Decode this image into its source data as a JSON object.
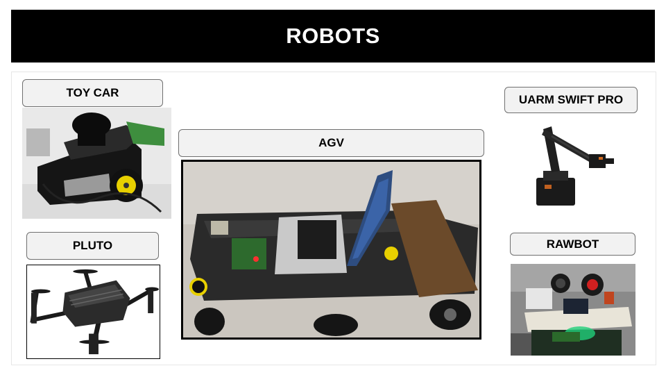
{
  "slide": {
    "title": "ROBOTS"
  },
  "robots": {
    "toy_car": {
      "label": "TOY CAR",
      "image": "toy-car-photo"
    },
    "pluto": {
      "label": "PLUTO",
      "image": "pluto-drone-image"
    },
    "agv": {
      "label": "AGV",
      "image": "agv-photo"
    },
    "uarm": {
      "label": "UARM SWIFT PRO",
      "image": "uarm-robot-arm-image"
    },
    "rawbot": {
      "label": "RAWBOT",
      "image": "rawbot-photo"
    }
  }
}
